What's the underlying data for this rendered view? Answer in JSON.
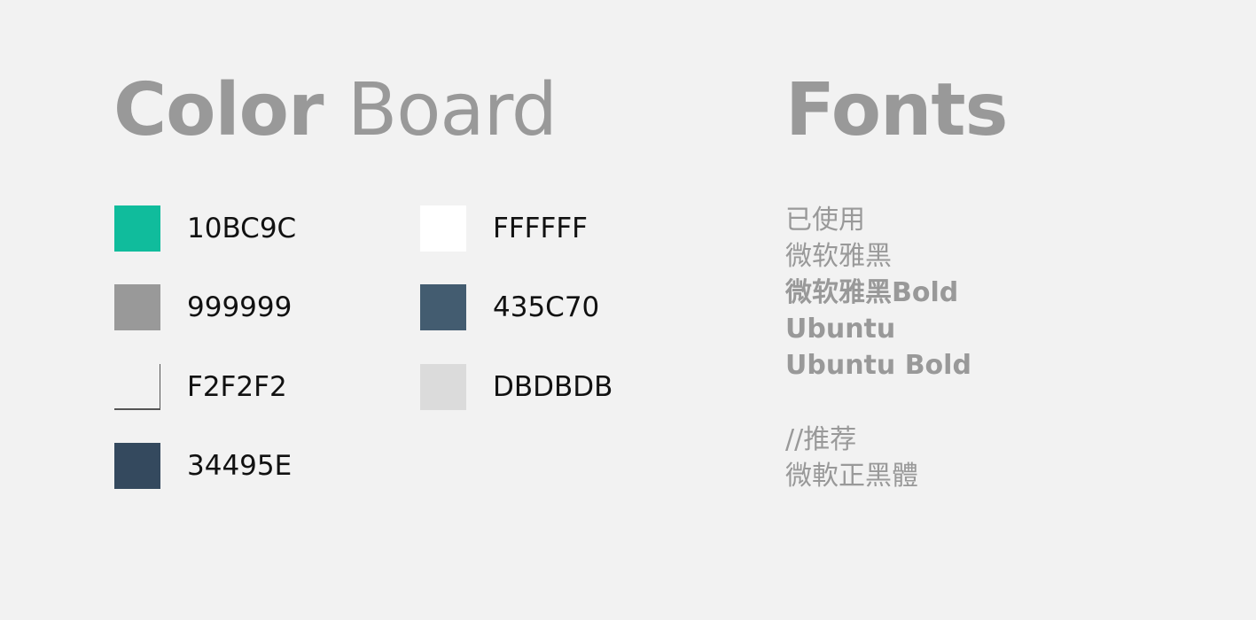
{
  "color_board": {
    "title_bold": "Color",
    "title_light": "Board",
    "swatches": [
      {
        "hex": "10BC9C",
        "color": "#10BC9C"
      },
      {
        "hex": "999999",
        "color": "#999999"
      },
      {
        "hex": "F2F2F2",
        "color": "#F2F2F2"
      },
      {
        "hex": "34495E",
        "color": "#34495E"
      },
      {
        "hex": "FFFFFF",
        "color": "#FFFFFF"
      },
      {
        "hex": "435C70",
        "color": "#435C70"
      },
      {
        "hex": "DBDBDB",
        "color": "#DBDBDB"
      }
    ]
  },
  "fonts": {
    "title": "Fonts",
    "used_heading": "已使用",
    "used": [
      {
        "label": "微软雅黑",
        "weight": "normal"
      },
      {
        "label": "微软雅黑Bold",
        "weight": "bold"
      },
      {
        "label": "Ubuntu",
        "weight": "bold"
      },
      {
        "label": "Ubuntu Bold",
        "weight": "bold"
      }
    ],
    "recommended_heading": "//推荐",
    "recommended": [
      {
        "label": "微軟正黑體",
        "weight": "normal"
      }
    ]
  },
  "colors": {
    "background": "#F2F2F2",
    "title_text": "#999999",
    "swatch_label_text": "#111111"
  }
}
